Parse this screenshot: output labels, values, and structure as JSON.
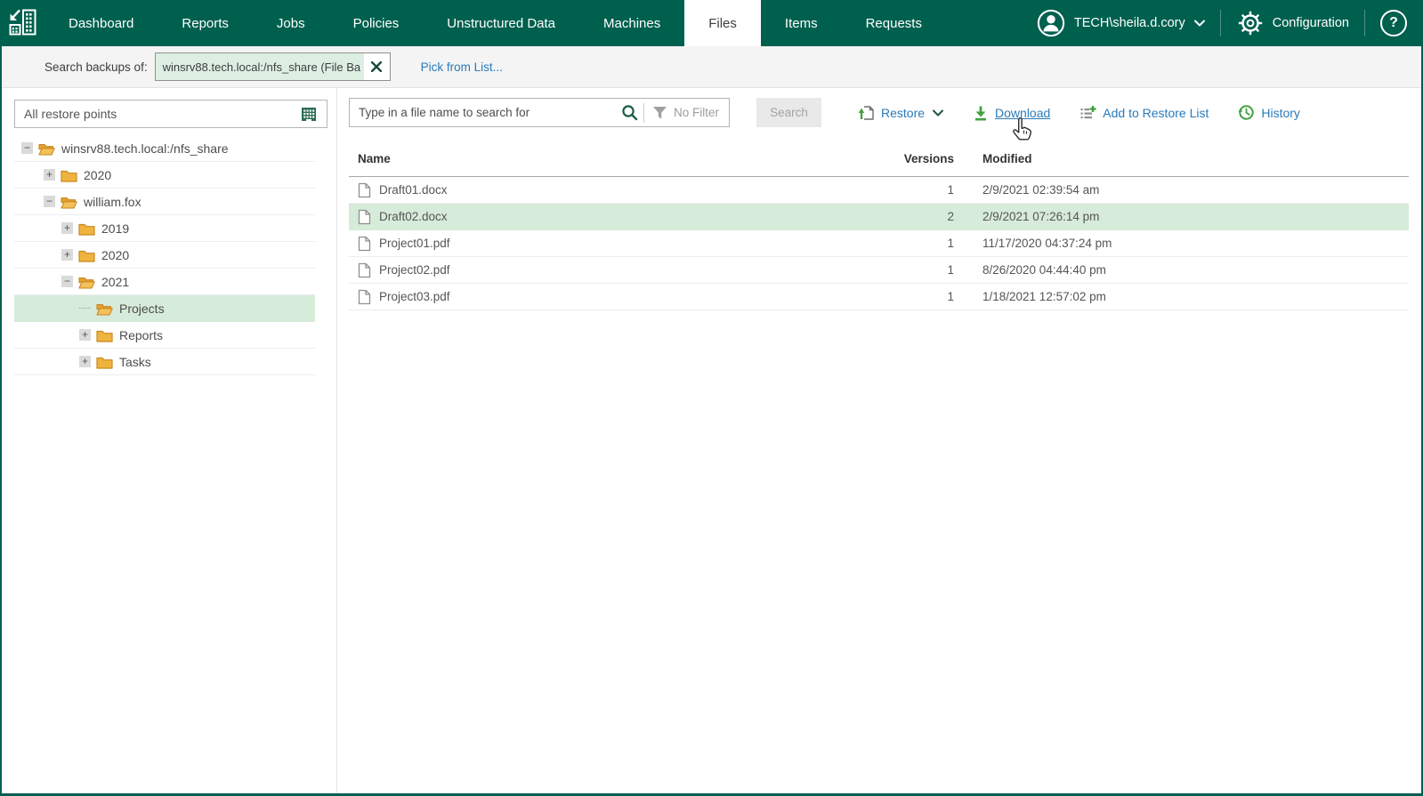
{
  "nav": {
    "tabs": [
      "Dashboard",
      "Reports",
      "Jobs",
      "Policies",
      "Unstructured Data",
      "Machines",
      "Files",
      "Items",
      "Requests"
    ],
    "active_tab": "Files",
    "user_label": "TECH\\sheila.d.cory",
    "configuration_label": "Configuration",
    "help_label": "?"
  },
  "subheader": {
    "search_backups_label": "Search backups of:",
    "scope_value": "winsrv88.tech.local:/nfs_share (File Ba",
    "pick_from_list_label": "Pick from List..."
  },
  "sidebar": {
    "restore_points_value": "All restore points",
    "tree": [
      {
        "label": "winsrv88.tech.local:/nfs_share",
        "level": 0,
        "expander": "minus",
        "folder": "open",
        "selected": false
      },
      {
        "label": "2020",
        "level": 1,
        "expander": "plus",
        "folder": "closed",
        "selected": false
      },
      {
        "label": "william.fox",
        "level": 1,
        "expander": "minus",
        "folder": "open",
        "selected": false
      },
      {
        "label": "2019",
        "level": 2,
        "expander": "plus",
        "folder": "closed",
        "selected": false
      },
      {
        "label": "2020",
        "level": 2,
        "expander": "plus",
        "folder": "closed",
        "selected": false
      },
      {
        "label": "2021",
        "level": 2,
        "expander": "minus",
        "folder": "open",
        "selected": false
      },
      {
        "label": "Projects",
        "level": 3,
        "expander": "none",
        "folder": "open",
        "selected": true
      },
      {
        "label": "Reports",
        "level": 3,
        "expander": "plus",
        "folder": "closed",
        "selected": false
      },
      {
        "label": "Tasks",
        "level": 3,
        "expander": "plus",
        "folder": "closed",
        "selected": false
      }
    ]
  },
  "toolbar": {
    "search_placeholder": "Type in a file name to search for",
    "no_filter_label": "No Filter",
    "search_button_label": "Search",
    "restore_label": "Restore",
    "download_label": "Download",
    "add_to_restore_list_label": "Add to Restore List",
    "history_label": "History"
  },
  "table": {
    "columns": [
      "Name",
      "Versions",
      "Modified"
    ],
    "rows": [
      {
        "name": "Draft01.docx",
        "versions": "1",
        "modified": "2/9/2021 02:39:54 am",
        "selected": false
      },
      {
        "name": "Draft02.docx",
        "versions": "2",
        "modified": "2/9/2021 07:26:14 pm",
        "selected": true
      },
      {
        "name": "Project01.pdf",
        "versions": "1",
        "modified": "11/17/2020 04:37:24 pm",
        "selected": false
      },
      {
        "name": "Project02.pdf",
        "versions": "1",
        "modified": "8/26/2020 04:44:40 pm",
        "selected": false
      },
      {
        "name": "Project03.pdf",
        "versions": "1",
        "modified": "1/18/2021 12:57:02 pm",
        "selected": false
      }
    ]
  },
  "icons": {
    "logo": "enterprise-manager-logo",
    "avatar": "user-person-circle",
    "gear": "configuration-gear",
    "help": "question-circle",
    "calendar": "restore-point-calendar",
    "search": "magnifier",
    "filter": "funnel",
    "restore": "page-with-up-arrow",
    "download": "down-arrow-to-bar",
    "add_to_restore_list": "list-with-plus",
    "history": "clock-with-arrow"
  },
  "colors": {
    "header_green": "#00604e",
    "selection_green": "#d6ebd9",
    "link_blue": "#2a7ab9",
    "action_green": "#42a142",
    "folder_yellow": "#efb43f"
  }
}
